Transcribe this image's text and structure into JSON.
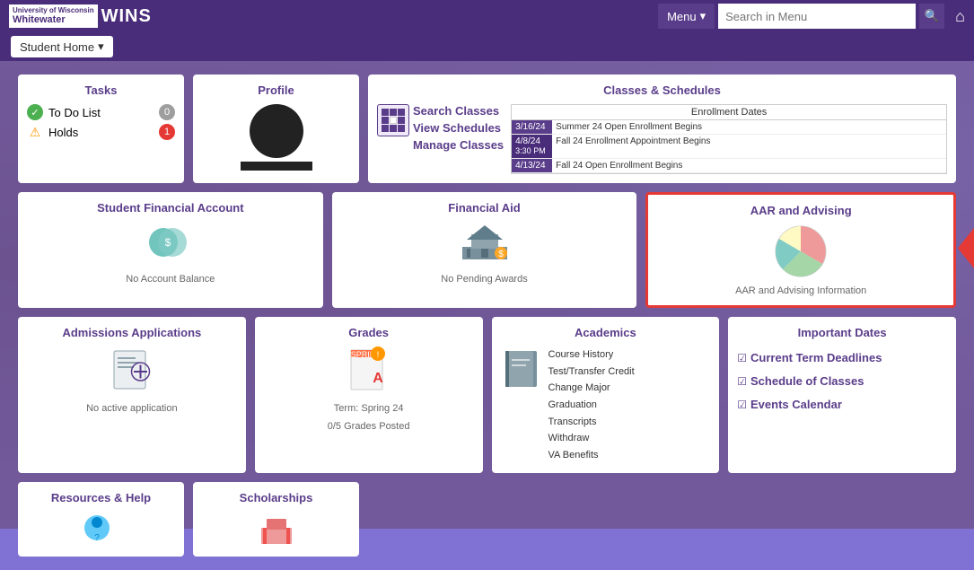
{
  "header": {
    "logo_text": "WINS",
    "logo_uww_line1": "University of Wisconsin",
    "logo_uww_line2": "Whitewater",
    "menu_label": "Menu",
    "search_placeholder": "Search in Menu",
    "home_icon": "⌂"
  },
  "subheader": {
    "student_home_label": "Student Home",
    "dropdown_icon": "▾"
  },
  "tiles": {
    "tasks": {
      "title": "Tasks",
      "todo_label": "To Do List",
      "todo_badge": "0",
      "holds_label": "Holds",
      "holds_badge": "1"
    },
    "profile": {
      "title": "Profile"
    },
    "classes": {
      "title": "Classes & Schedules",
      "link1": "Search Classes",
      "link2": "View Schedules",
      "link3": "Manage Classes",
      "enrollment_header": "Enrollment Dates",
      "rows": [
        {
          "date": "3/16/24",
          "text": "Summer 24 Open Enrollment Begins"
        },
        {
          "date": "4/8/24",
          "time": "3:30 PM",
          "text": "Fall 24 Enrollment Appointment Begins"
        },
        {
          "date": "4/13/24",
          "text": "Fall 24 Open Enrollment Begins"
        }
      ]
    },
    "student_financial": {
      "title": "Student Financial Account",
      "subtitle": "No Account Balance"
    },
    "financial_aid": {
      "title": "Financial Aid",
      "subtitle": "No Pending Awards"
    },
    "aar": {
      "title": "AAR and Advising",
      "subtitle": "AAR and Advising Information"
    },
    "admissions": {
      "title": "Admissions Applications",
      "subtitle": "No active application"
    },
    "grades": {
      "title": "Grades",
      "term": "Term:  Spring 24",
      "posted": "0/5 Grades Posted"
    },
    "academics": {
      "title": "Academics",
      "links": [
        "Course History",
        "Test/Transfer Credit",
        "Change Major",
        "Graduation",
        "Transcripts",
        "Withdraw",
        "VA Benefits"
      ]
    },
    "important_dates": {
      "title": "Important Dates",
      "links": [
        "Current Term Deadlines",
        "Schedule of Classes",
        "Events Calendar"
      ]
    },
    "resources": {
      "title": "Resources & Help"
    },
    "scholarships": {
      "title": "Scholarships"
    }
  }
}
